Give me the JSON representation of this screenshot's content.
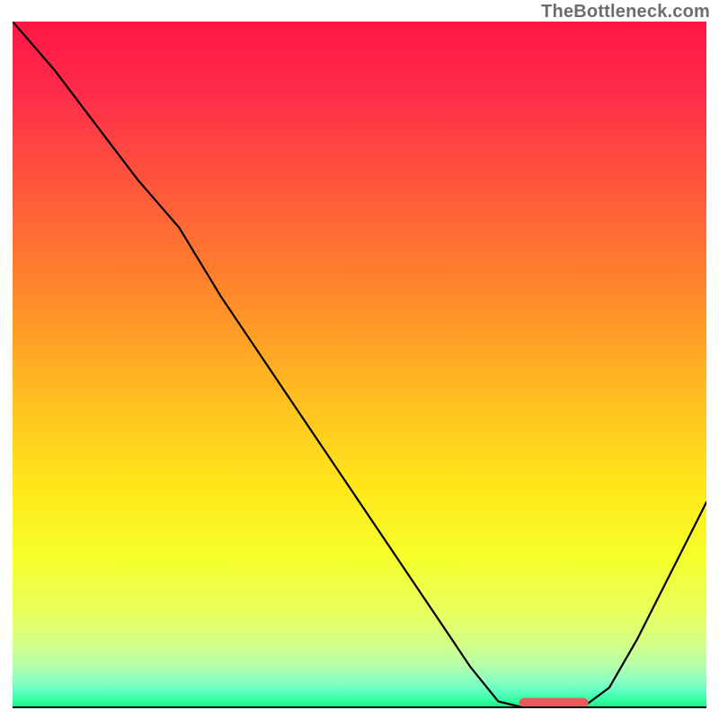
{
  "watermark": "TheBottleneck.com",
  "colors": {
    "curve": "#000000",
    "marker": "#ea5a5a",
    "gradient_top": "#ff1744",
    "gradient_bottom": "#18e878"
  },
  "chart_data": {
    "type": "line",
    "title": "",
    "xlabel": "",
    "ylabel": "",
    "xlim": [
      0,
      100
    ],
    "ylim": [
      0,
      100
    ],
    "x": [
      0,
      6,
      12,
      18,
      24,
      30,
      36,
      42,
      48,
      54,
      60,
      66,
      70,
      74,
      78,
      82,
      86,
      90,
      94,
      98,
      100
    ],
    "values": [
      100,
      93,
      85,
      77,
      70,
      60,
      51,
      42,
      33,
      24,
      15,
      6,
      1,
      0,
      0,
      0,
      3,
      10,
      18,
      26,
      30
    ],
    "optimal_range_x": [
      73,
      83
    ],
    "optimal_range_y": 0.8,
    "marker_height": 1.4
  }
}
